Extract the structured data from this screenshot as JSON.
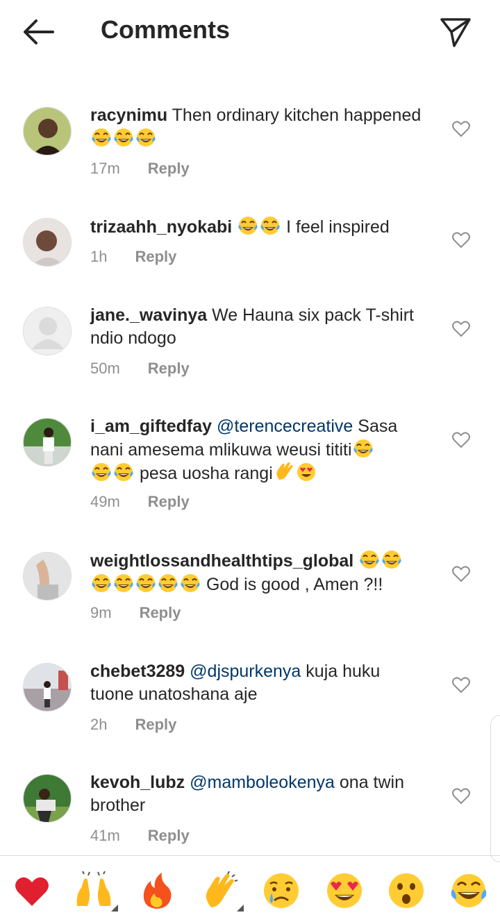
{
  "header": {
    "title": "Comments"
  },
  "comments": [
    {
      "user": "racynimu",
      "pre": " Then ordinary kitchen happened ",
      "mention": "",
      "post": "",
      "emoji_tail": 3,
      "time": "17m",
      "reply": "Reply"
    },
    {
      "user": "trizaahh_nyokabi",
      "pre": " ",
      "mention": "",
      "post": "",
      "emoji_mid": 2,
      "tail_text": " I feel inspired",
      "time": "1h",
      "reply": "Reply"
    },
    {
      "user": "jane._wavinya",
      "pre": " We Hauna six pack T-shirt ndio  ndogo",
      "mention": "",
      "post": "",
      "time": "50m",
      "reply": "Reply"
    },
    {
      "user": "i_am_giftedfay",
      "pre": " ",
      "mention": "@terencecreative",
      "post": " Sasa nani amesema mlikuwa weusi tititi",
      "line2_text": " pesa uosha rangi",
      "time": "49m",
      "reply": "Reply"
    },
    {
      "user": "weightlossandhealthtips_global",
      "pre": " ",
      "mention": "",
      "post": "",
      "tail_text": " God is good , Amen ?!!",
      "time": "9m",
      "reply": "Reply"
    },
    {
      "user": "chebet3289",
      "pre": " ",
      "mention": "@djspurkenya",
      "post": " kuja huku tuone unatoshana aje",
      "time": "2h",
      "reply": "Reply"
    },
    {
      "user": "kevoh_lubz",
      "pre": " ",
      "mention": "@mamboleokenya",
      "post": " ona twin brother",
      "time": "41m",
      "reply": "Reply"
    }
  ],
  "reactions": [
    "heart-emoji",
    "raising-hands-emoji",
    "fire-emoji",
    "clapping-hands-emoji",
    "crying-face-emoji",
    "heart-eyes-emoji",
    "surprised-face-emoji",
    "tears-of-joy-emoji"
  ],
  "colors": {
    "text": "#262626",
    "meta": "#8e8e8e",
    "mention": "#00376b",
    "divider": "#dbdbdb"
  }
}
